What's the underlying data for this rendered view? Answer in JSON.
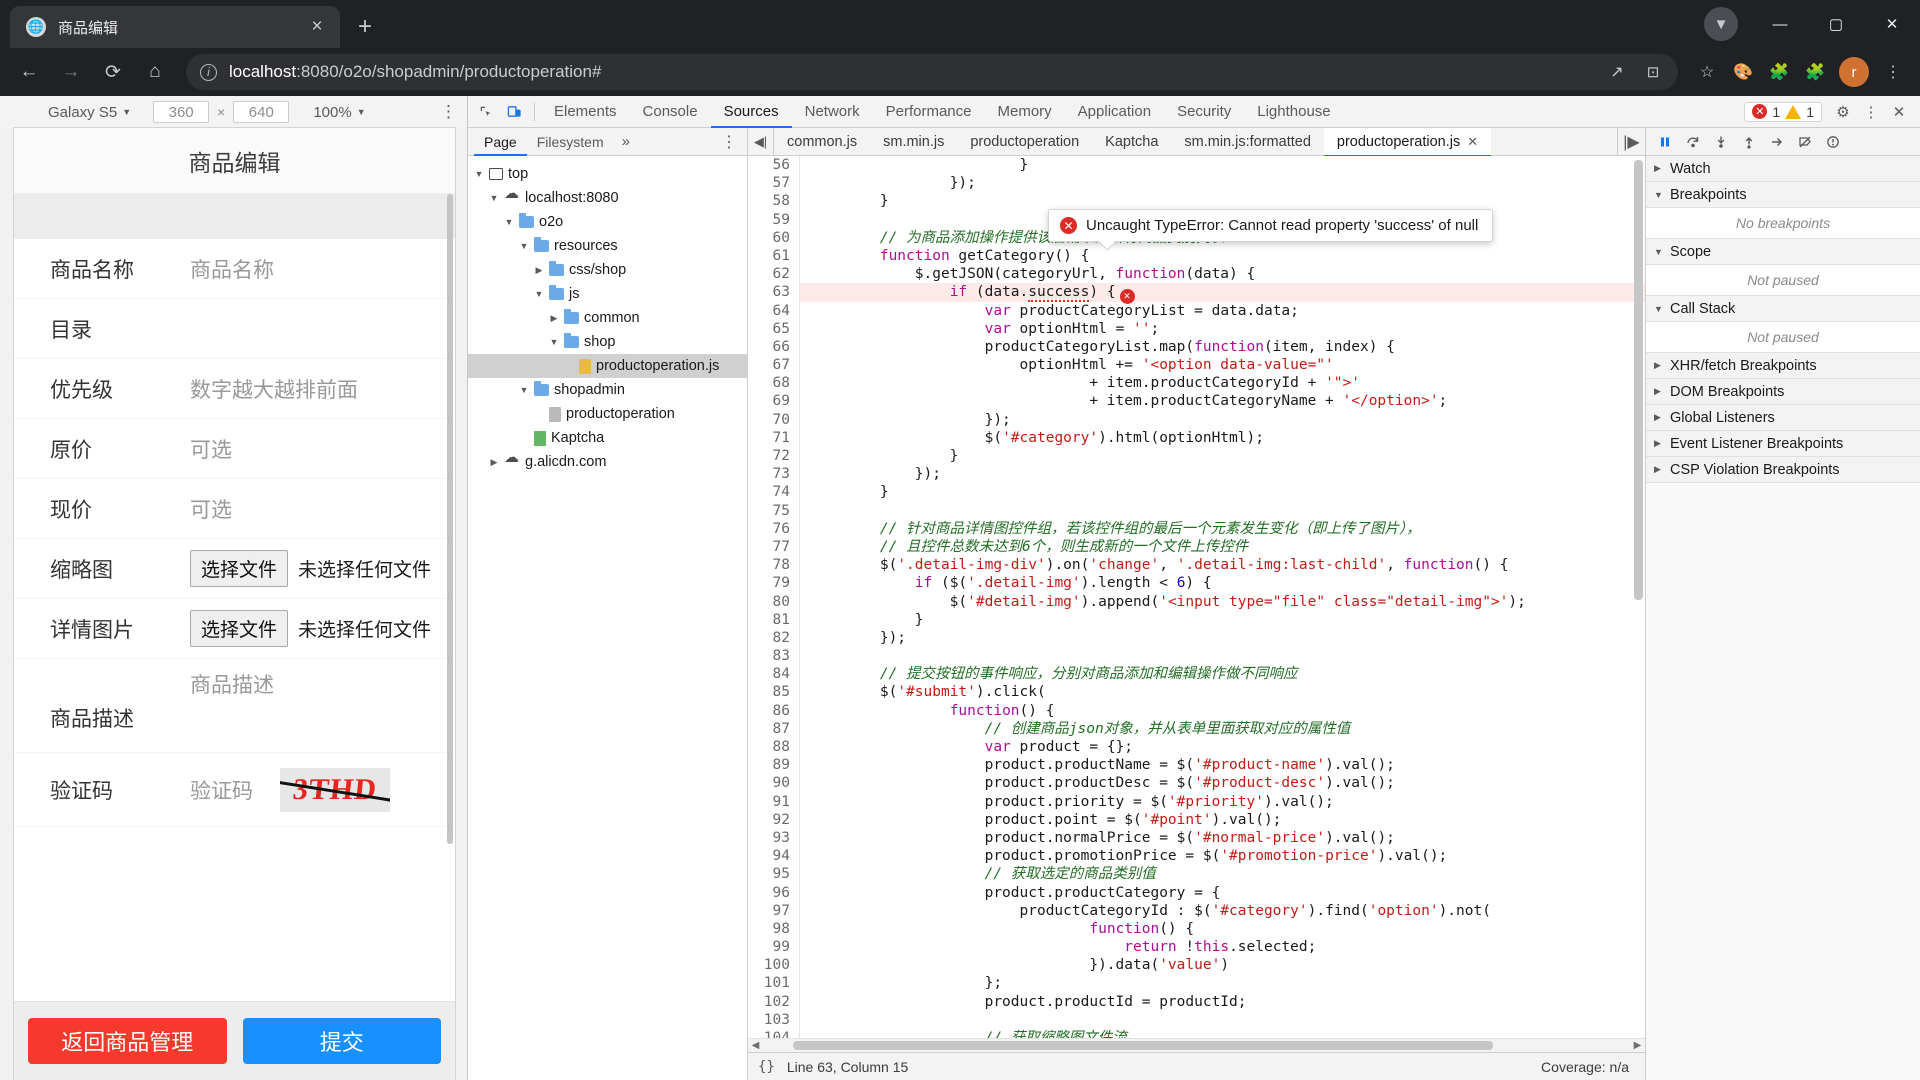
{
  "browser": {
    "tab": {
      "title": "商品编辑",
      "favicon_icon": "globe-icon",
      "close_icon": "×"
    },
    "new_tab_icon": "+",
    "window_controls": {
      "minimize": "—",
      "maximize": "▢",
      "close": "✕",
      "update_icon": "▼"
    },
    "nav": {
      "back_icon": "←",
      "forward_icon": "→",
      "reload_icon": "⟳",
      "home_icon": "⌂"
    },
    "omnibox": {
      "info_icon": "i",
      "url_host": "localhost",
      "url_path": ":8080/o2o/shopadmin/productoperation#",
      "share_icon": "↗",
      "install_icon": "⊡",
      "star_icon": "☆"
    },
    "extensions": [
      "palette-icon",
      "translate-icon",
      "puzzle-icon"
    ],
    "avatar_letter": "r",
    "menu_icon": "⋮"
  },
  "device_toolbar": {
    "device": "Galaxy S5",
    "caret": "▼",
    "width": "360",
    "height": "640",
    "x_label": "×",
    "zoom": "100%",
    "more_icon": "⋮"
  },
  "page": {
    "title": "商品编辑",
    "fields": [
      {
        "label": "商品名称",
        "placeholder": "商品名称",
        "type": "text"
      },
      {
        "label": "目录",
        "placeholder": "",
        "type": "select"
      },
      {
        "label": "优先级",
        "placeholder": "数字越大越排前面",
        "type": "text"
      },
      {
        "label": "原价",
        "placeholder": "可选",
        "type": "text"
      },
      {
        "label": "现价",
        "placeholder": "可选",
        "type": "text"
      }
    ],
    "file_fields": [
      {
        "label": "缩略图",
        "button": "选择文件",
        "status": "未选择任何文件"
      },
      {
        "label": "详情图片",
        "button": "选择文件",
        "status": "未选择任何文件"
      }
    ],
    "desc_field": {
      "label": "商品描述",
      "placeholder": "商品描述"
    },
    "captcha_field": {
      "label": "验证码",
      "placeholder": "验证码",
      "image_text": "3THD"
    },
    "buttons": {
      "back": "返回商品管理",
      "submit": "提交",
      "back_color": "#f5392c",
      "submit_color": "#1890ff"
    }
  },
  "devtools": {
    "tools": {
      "inspect_icon": "inspect-icon",
      "device_icon": "device-toggle-icon"
    },
    "tabs": [
      {
        "label": "Elements",
        "selected": false
      },
      {
        "label": "Console",
        "selected": false
      },
      {
        "label": "Sources",
        "selected": true
      },
      {
        "label": "Network",
        "selected": false
      },
      {
        "label": "Performance",
        "selected": false
      },
      {
        "label": "Memory",
        "selected": false
      },
      {
        "label": "Application",
        "selected": false
      },
      {
        "label": "Security",
        "selected": false
      },
      {
        "label": "Lighthouse",
        "selected": false
      }
    ],
    "error_count": "1",
    "warning_count": "1",
    "settings_icon": "⚙",
    "more_icon": "⋮",
    "close_icon": "✕",
    "navigator": {
      "tabs": [
        {
          "label": "Page",
          "selected": true
        },
        {
          "label": "Filesystem",
          "selected": false
        }
      ],
      "more_label": "»",
      "dots_icon": "⋮",
      "tree": [
        {
          "label": "top",
          "indent": 0,
          "tri": "▼",
          "icon": "frame"
        },
        {
          "label": "localhost:8080",
          "indent": 1,
          "tri": "▼",
          "icon": "cloud"
        },
        {
          "label": "o2o",
          "indent": 2,
          "tri": "▼",
          "icon": "folder"
        },
        {
          "label": "resources",
          "indent": 3,
          "tri": "▼",
          "icon": "folder"
        },
        {
          "label": "css/shop",
          "indent": 4,
          "tri": "▶",
          "icon": "folder"
        },
        {
          "label": "js",
          "indent": 4,
          "tri": "▼",
          "icon": "folder"
        },
        {
          "label": "common",
          "indent": 5,
          "tri": "▶",
          "icon": "folder"
        },
        {
          "label": "shop",
          "indent": 5,
          "tri": "▼",
          "icon": "folder"
        },
        {
          "label": "productoperation.js",
          "indent": 6,
          "tri": "",
          "icon": "file-js",
          "selected": true
        },
        {
          "label": "shopadmin",
          "indent": 3,
          "tri": "▼",
          "icon": "folder"
        },
        {
          "label": "productoperation",
          "indent": 4,
          "tri": "",
          "icon": "file-doc"
        },
        {
          "label": "Kaptcha",
          "indent": 3,
          "tri": "",
          "icon": "file-green"
        },
        {
          "label": "g.alicdn.com",
          "indent": 1,
          "tri": "▶",
          "icon": "cloud"
        }
      ]
    },
    "editor_tabs": [
      {
        "label": "common.js",
        "selected": false
      },
      {
        "label": "sm.min.js",
        "selected": false
      },
      {
        "label": "productoperation",
        "selected": false
      },
      {
        "label": "Kaptcha",
        "selected": false
      },
      {
        "label": "sm.min.js:formatted",
        "selected": false
      },
      {
        "label": "productoperation.js",
        "selected": true,
        "close": "✕"
      }
    ],
    "editor_scroll_left_icon": "◀|",
    "editor_scroll_right_icon": "|▶",
    "error_tooltip": "Uncaught TypeError: Cannot read property 'success' of null",
    "status": {
      "pretty_print_icon": "{}",
      "cursor": "Line 63, Column 15",
      "coverage": "Coverage: n/a"
    },
    "debug_controls": [
      "pause-icon",
      "step-over-icon",
      "step-into-icon",
      "step-out-icon",
      "step-icon",
      "deactivate-breakpoints-icon",
      "pause-on-exceptions-icon"
    ],
    "sidebar_sections": [
      {
        "label": "Watch",
        "tri": "▶",
        "body": null
      },
      {
        "label": "Breakpoints",
        "tri": "▼",
        "body": "No breakpoints"
      },
      {
        "label": "Scope",
        "tri": "▼",
        "body": "Not paused"
      },
      {
        "label": "Call Stack",
        "tri": "▼",
        "body": "Not paused"
      },
      {
        "label": "XHR/fetch Breakpoints",
        "tri": "▶",
        "body": null
      },
      {
        "label": "DOM Breakpoints",
        "tri": "▶",
        "body": null
      },
      {
        "label": "Global Listeners",
        "tri": "▶",
        "body": null
      },
      {
        "label": "Event Listener Breakpoints",
        "tri": "▶",
        "body": null
      },
      {
        "label": "CSP Violation Breakpoints",
        "tri": "▶",
        "body": null
      }
    ]
  },
  "code": {
    "first_line": 56,
    "highlight_line": 63,
    "lines": [
      {
        "n": 56,
        "html": "                        }"
      },
      {
        "n": 57,
        "html": "                <span class=\"plain\">});</span>"
      },
      {
        "n": 58,
        "html": "        }"
      },
      {
        "n": 59,
        "html": ""
      },
      {
        "n": 60,
        "html": "        <span class=\"com\">// 为商品添加操作提供该店铺下的所有商品类别列表</span>"
      },
      {
        "n": 61,
        "html": "        <span class=\"kw\">function</span> <span class=\"fn\">getCategory</span>() {"
      },
      {
        "n": 62,
        "html": "            $.getJSON(categoryUrl, <span class=\"kw\">function</span>(data) {"
      },
      {
        "n": 63,
        "html": "                <span class=\"kw\">if</span> (data.<span class=\"err-squig\">success</span>) {"
      },
      {
        "n": 64,
        "html": "                    <span class=\"kw\">var</span> productCategoryList = data.data;"
      },
      {
        "n": 65,
        "html": "                    <span class=\"kw\">var</span> optionHtml = <span class=\"str\">''</span>;"
      },
      {
        "n": 66,
        "html": "                    productCategoryList.map(<span class=\"kw\">function</span>(item, index) {"
      },
      {
        "n": 67,
        "html": "                        optionHtml += <span class=\"str\">'&lt;option data-value=\"'</span>"
      },
      {
        "n": 68,
        "html": "                                + item.productCategoryId + <span class=\"str\">'\"&gt;'</span>"
      },
      {
        "n": 69,
        "html": "                                + item.productCategoryName + <span class=\"str\">'&lt;/option&gt;'</span>;"
      },
      {
        "n": 70,
        "html": "                    });"
      },
      {
        "n": 71,
        "html": "                    $(<span class=\"str\">'#category'</span>).html(optionHtml);"
      },
      {
        "n": 72,
        "html": "                }"
      },
      {
        "n": 73,
        "html": "            });"
      },
      {
        "n": 74,
        "html": "        }"
      },
      {
        "n": 75,
        "html": ""
      },
      {
        "n": 76,
        "html": "        <span class=\"com\">// 针对商品详情图控件组，若该控件组的最后一个元素发生变化（即上传了图片），</span>"
      },
      {
        "n": 77,
        "html": "        <span class=\"com\">// 且控件总数未达到6个，则生成新的一个文件上传控件</span>"
      },
      {
        "n": 78,
        "html": "        $(<span class=\"str\">'.detail-img-div'</span>).on(<span class=\"str\">'change'</span>, <span class=\"str\">'.detail-img:last-child'</span>, <span class=\"kw\">function</span>() {"
      },
      {
        "n": 79,
        "html": "            <span class=\"kw\">if</span> ($(<span class=\"str\">'.detail-img'</span>).length &lt; <span class=\"num\">6</span>) {"
      },
      {
        "n": 80,
        "html": "                $(<span class=\"str\">'#detail-img'</span>).append(<span class=\"str\">'&lt;input type=\"file\" class=\"detail-img\"&gt;'</span>);"
      },
      {
        "n": 81,
        "html": "            }"
      },
      {
        "n": 82,
        "html": "        });"
      },
      {
        "n": 83,
        "html": ""
      },
      {
        "n": 84,
        "html": "        <span class=\"com\">// 提交按钮的事件响应，分别对商品添加和编辑操作做不同响应</span>"
      },
      {
        "n": 85,
        "html": "        $(<span class=\"str\">'#submit'</span>).click("
      },
      {
        "n": 86,
        "html": "                <span class=\"kw\">function</span>() {"
      },
      {
        "n": 87,
        "html": "                    <span class=\"com\">// 创建商品json对象，并从表单里面获取对应的属性值</span>"
      },
      {
        "n": 88,
        "html": "                    <span class=\"kw\">var</span> product = {};"
      },
      {
        "n": 89,
        "html": "                    product.productName = $(<span class=\"str\">'#product-name'</span>).val();"
      },
      {
        "n": 90,
        "html": "                    product.productDesc = $(<span class=\"str\">'#product-desc'</span>).val();"
      },
      {
        "n": 91,
        "html": "                    product.priority = $(<span class=\"str\">'#priority'</span>).val();"
      },
      {
        "n": 92,
        "html": "                    product.point = $(<span class=\"str\">'#point'</span>).val();"
      },
      {
        "n": 93,
        "html": "                    product.normalPrice = $(<span class=\"str\">'#normal-price'</span>).val();"
      },
      {
        "n": 94,
        "html": "                    product.promotionPrice = $(<span class=\"str\">'#promotion-price'</span>).val();"
      },
      {
        "n": 95,
        "html": "                    <span class=\"com\">// 获取选定的商品类别值</span>"
      },
      {
        "n": 96,
        "html": "                    product.productCategory = {"
      },
      {
        "n": 97,
        "html": "                        productCategoryId : $(<span class=\"str\">'#category'</span>).find(<span class=\"str\">'option'</span>).not("
      },
      {
        "n": 98,
        "html": "                                <span class=\"kw\">function</span>() {"
      },
      {
        "n": 99,
        "html": "                                    <span class=\"kw\">return</span> !<span class=\"kw\">this</span>.selected;"
      },
      {
        "n": 100,
        "html": "                                }).data(<span class=\"str\">'value'</span>)"
      },
      {
        "n": 101,
        "html": "                    };"
      },
      {
        "n": 102,
        "html": "                    product.productId = productId;"
      },
      {
        "n": 103,
        "html": ""
      },
      {
        "n": 104,
        "html": "                    <span class=\"com\">// 获取缩略图文件流</span>"
      },
      {
        "n": 105,
        "html": ""
      }
    ]
  }
}
